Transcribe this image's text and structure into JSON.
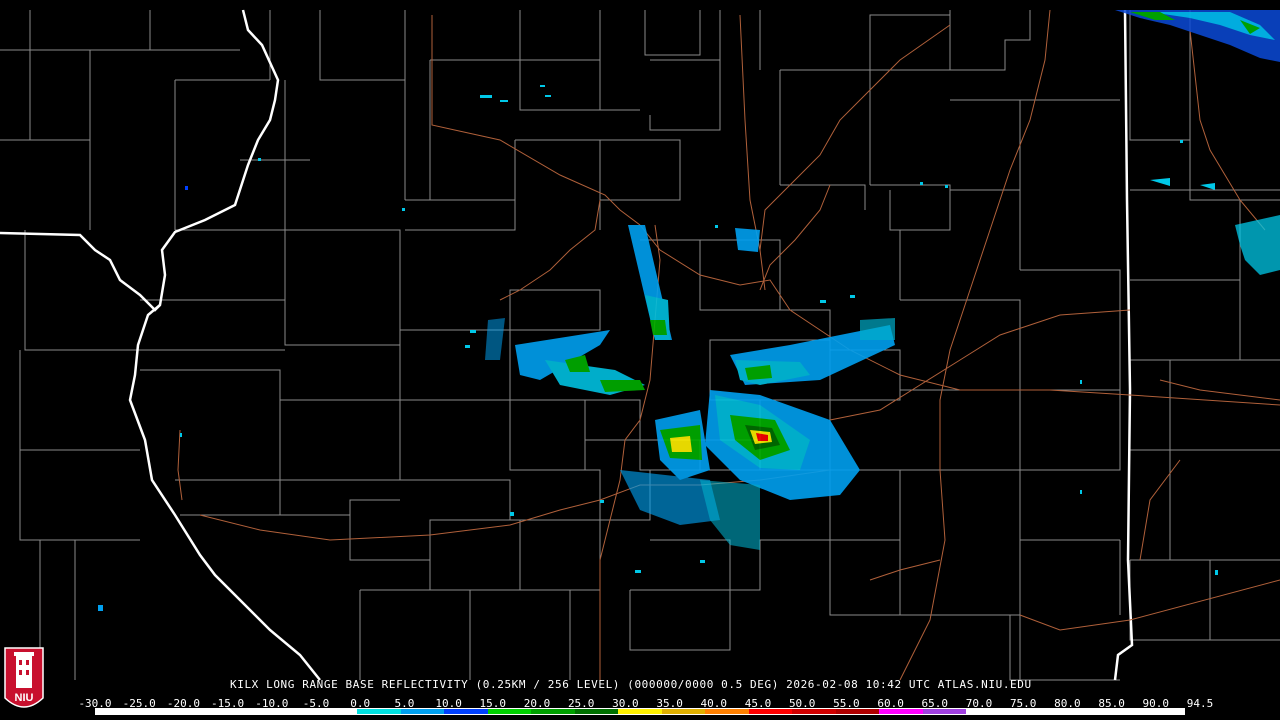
{
  "map": {
    "caption": "KILX LONG RANGE BASE REFLECTIVITY (0.25KM / 256 LEVEL) (000000/0000 0.5 DEG) 2026-02-08 10:42 UTC  ATLAS.NIU.EDU",
    "colors": {
      "background": "#000000",
      "county_lines": "#8a8a8a",
      "state_lines": "#ffffff",
      "highways": "#b0603a"
    }
  },
  "scale": {
    "labels": [
      "-30.0",
      "-25.0",
      "-20.0",
      "-15.0",
      "-10.0",
      "-5.0",
      "0.0",
      "5.0",
      "10.0",
      "15.0",
      "20.0",
      "25.0",
      "30.0",
      "35.0",
      "40.0",
      "45.0",
      "50.0",
      "55.0",
      "60.0",
      "65.0",
      "70.0",
      "75.0",
      "80.0",
      "85.0",
      "90.0",
      "94.5"
    ],
    "colors": [
      "#ffffff",
      "#ffffff",
      "#ffffff",
      "#ffffff",
      "#ffffff",
      "#ffffff",
      "#00e0e0",
      "#00a0f0",
      "#0040ff",
      "#00d000",
      "#00a000",
      "#007000",
      "#fff000",
      "#e0b000",
      "#ff8000",
      "#ff0000",
      "#d00000",
      "#b00000",
      "#ff00ff",
      "#a040e0",
      "#ffffff",
      "#ffffff",
      "#ffffff",
      "#ffffff",
      "#ffffff"
    ]
  },
  "logo": {
    "text": "NIU",
    "colors": {
      "shield": "#c8102e",
      "tower": "#ffffff"
    }
  }
}
